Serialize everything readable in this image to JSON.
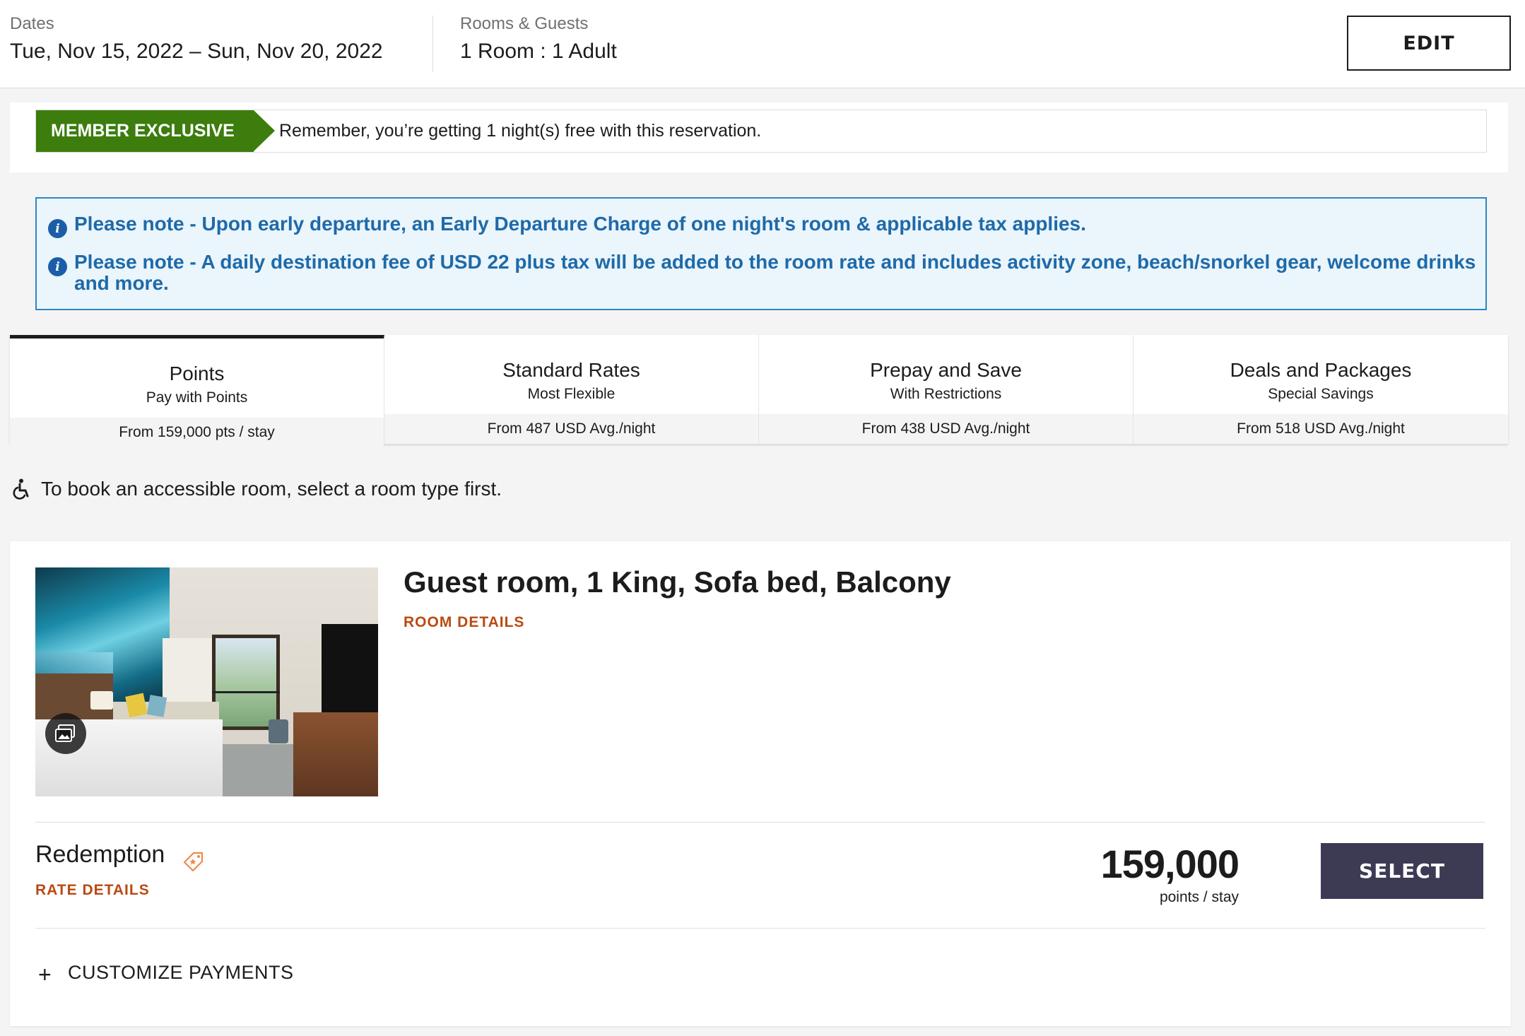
{
  "search": {
    "dates_label": "Dates",
    "dates_value": "Tue, Nov 15, 2022 – Sun, Nov 20, 2022",
    "guests_label": "Rooms & Guests",
    "guests_value": "1 Room : 1 Adult",
    "edit_label": "EDIT"
  },
  "member_banner": {
    "tag": "MEMBER EXCLUSIVE",
    "message": "Remember, you’re getting 1 night(s) free with this reservation."
  },
  "notes": [
    "Please note - Upon early departure, an Early Departure Charge of one night's room & applicable tax applies.",
    "Please note - A daily destination fee of USD 22 plus tax will be added to the room rate and includes activity zone, beach/snorkel gear, welcome drinks and more."
  ],
  "rate_tabs": [
    {
      "title": "Points",
      "subtitle": "Pay with Points",
      "from": "From 159,000 pts / stay",
      "active": true
    },
    {
      "title": "Standard Rates",
      "subtitle": "Most Flexible",
      "from": "From 487 USD Avg./night",
      "active": false
    },
    {
      "title": "Prepay and Save",
      "subtitle": "With Restrictions",
      "from": "From 438 USD Avg./night",
      "active": false
    },
    {
      "title": "Deals and Packages",
      "subtitle": "Special Savings",
      "from": "From 518 USD Avg./night",
      "active": false
    }
  ],
  "accessible_note": "To book an accessible room, select a room type first.",
  "room": {
    "title": "Guest room, 1 King, Sofa bed, Balcony",
    "details_link": "ROOM DETAILS",
    "rate_name": "Redemption",
    "rate_details_link": "RATE DETAILS",
    "points": "159,000",
    "points_unit": "points / stay",
    "select_label": "SELECT",
    "customize_label": "CUSTOMIZE PAYMENTS"
  },
  "icons": {
    "info": "info-icon",
    "accessible": "wheelchair-icon",
    "gallery": "gallery-icon",
    "tag": "tag-icon",
    "expand": "plus-icon"
  },
  "colors": {
    "member_green": "#3c7d0e",
    "note_blue": "#1f6aa8",
    "link_orange": "#b84a12",
    "select_button": "#3d3b54"
  }
}
